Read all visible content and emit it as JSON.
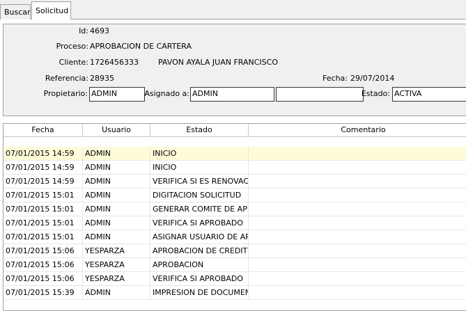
{
  "tabs": [
    {
      "label": "Buscar"
    },
    {
      "label": "Solicitud"
    }
  ],
  "header": {
    "id_label": "Id:",
    "id_value": "4693",
    "proceso_label": "Proceso:",
    "proceso_value": "APROBACION DE CARTERA",
    "cliente_label": "Cliente:",
    "cliente_id": "1726456333",
    "cliente_nombre": "PAVON AYALA JUAN FRANCISCO",
    "referencia_label": "Referencia:",
    "referencia_value": "28935",
    "fecha_label": "Fecha:",
    "fecha_value": "29/07/2014",
    "propietario_label": "Propietario:",
    "propietario_value": "ADMIN",
    "asignado_label": "Asignado a:",
    "asignado_value": "ADMIN",
    "asignado_extra": "",
    "estado_label": "Estado:",
    "estado_value": "ACTIVA"
  },
  "grid": {
    "columns": [
      "Fecha",
      "Usuario",
      "Estado",
      "Comentario"
    ],
    "rows": [
      {
        "fecha": "07/01/2015 14:59",
        "usuario": "ADMIN",
        "estado": "INICIO",
        "comentario": ""
      },
      {
        "fecha": "07/01/2015 14:59",
        "usuario": "ADMIN",
        "estado": "INICIO",
        "comentario": ""
      },
      {
        "fecha": "07/01/2015 14:59",
        "usuario": "ADMIN",
        "estado": "VERIFICA SI ES RENOVACI...",
        "comentario": ""
      },
      {
        "fecha": "07/01/2015 15:01",
        "usuario": "ADMIN",
        "estado": "DIGITACION SOLICITUD",
        "comentario": ""
      },
      {
        "fecha": "07/01/2015 15:01",
        "usuario": "ADMIN",
        "estado": "GENERAR COMITE DE APR...",
        "comentario": ""
      },
      {
        "fecha": "07/01/2015 15:01",
        "usuario": "ADMIN",
        "estado": "VERIFICA SI APROBADO",
        "comentario": ""
      },
      {
        "fecha": "07/01/2015 15:01",
        "usuario": "ADMIN",
        "estado": "ASIGNAR USUARIO DE AP...",
        "comentario": ""
      },
      {
        "fecha": "07/01/2015 15:06",
        "usuario": "YESPARZA",
        "estado": "APROBACION DE CREDITO",
        "comentario": ""
      },
      {
        "fecha": "07/01/2015 15:06",
        "usuario": "YESPARZA",
        "estado": "APROBACION",
        "comentario": ""
      },
      {
        "fecha": "07/01/2015 15:06",
        "usuario": "YESPARZA",
        "estado": "VERIFICA SI APROBADO",
        "comentario": ""
      },
      {
        "fecha": "07/01/2015 15:39",
        "usuario": "ADMIN",
        "estado": "IMPRESION DE DOCUMENT...",
        "comentario": ""
      }
    ]
  },
  "colors": {
    "selected_row": "#fefbd9",
    "panel_bg": "#f0f0f0"
  }
}
